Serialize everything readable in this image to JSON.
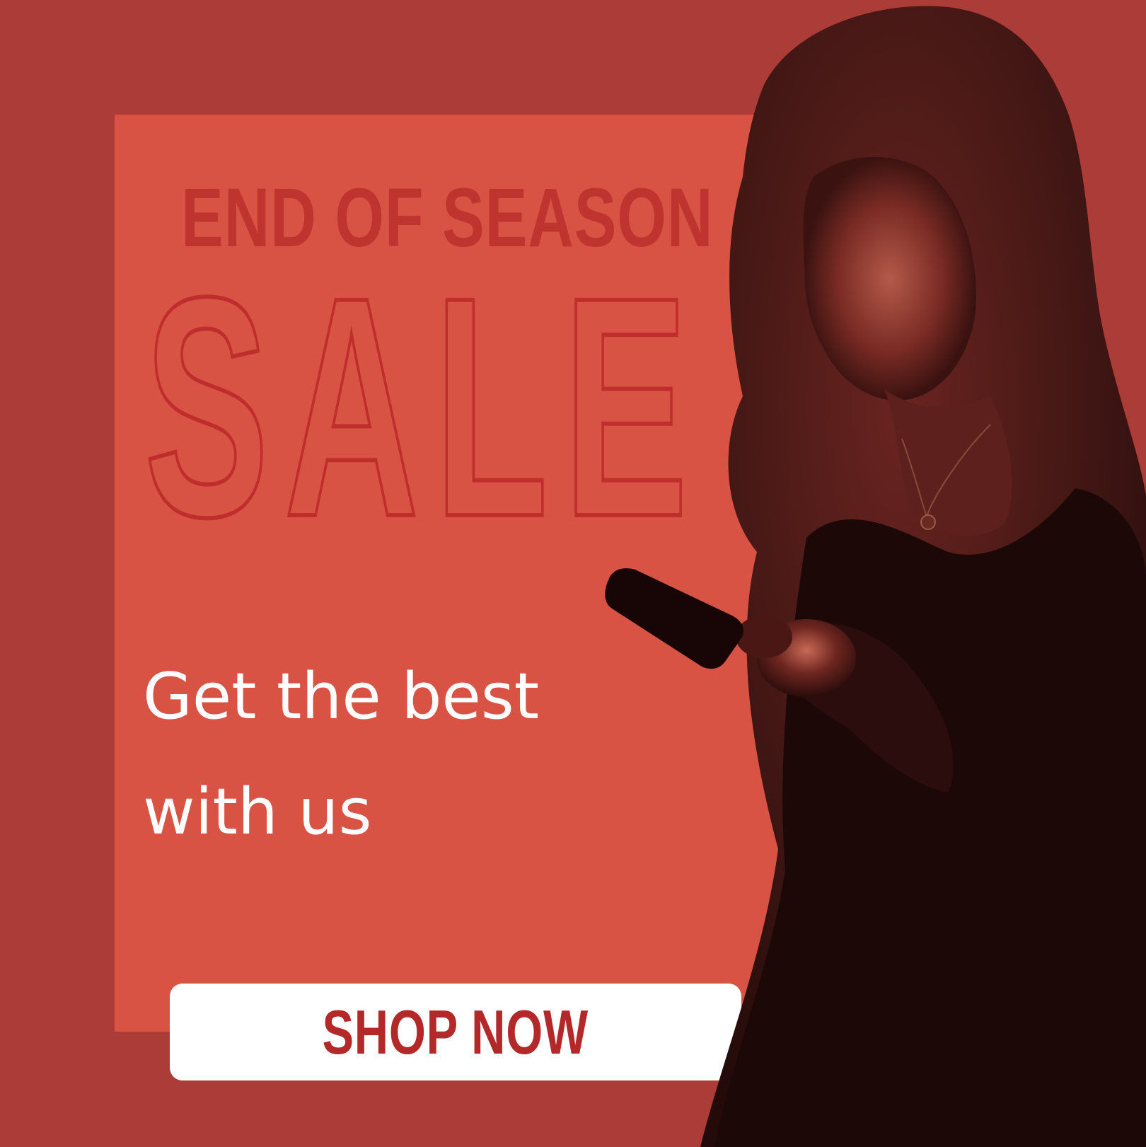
{
  "banner": {
    "headline": "END OF SEASON",
    "sale_word": "SALE",
    "tagline_line1": "Get the best",
    "tagline_line2": "with us",
    "cta_label": "SHOP NOW"
  },
  "colors": {
    "outer_background": "#ac3c37",
    "inner_panel": "#d95344",
    "headline_text": "#c0342f",
    "sale_outline": "#bf2e2c",
    "tagline_text": "#ffffff",
    "button_background": "#ffffff",
    "button_text": "#b3292a"
  },
  "photo": {
    "subject": "woman-looking-at-phone-photo"
  }
}
